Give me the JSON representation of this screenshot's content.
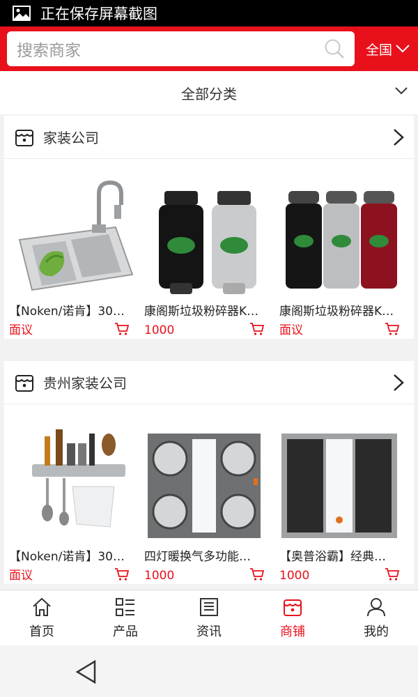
{
  "status_bar": {
    "text": "正在保存屏幕截图",
    "icon": "image-icon"
  },
  "search": {
    "placeholder": "搜索商家",
    "region": "全国"
  },
  "category_bar": {
    "label": "全部分类"
  },
  "shops": [
    {
      "name": "家装公司",
      "products": [
        {
          "title": "【Noken/诺肯】30…",
          "price": "面议",
          "image": "kitchen-sink"
        },
        {
          "title": "康阁斯垃圾粉碎器K…",
          "price": "1000",
          "image": "garbage-disposer-pair"
        },
        {
          "title": "康阁斯垃圾粉碎器K…",
          "price": "面议",
          "image": "garbage-disposer-trio"
        }
      ]
    },
    {
      "name": "贵州家装公司",
      "products": [
        {
          "title": "【Noken/诺肯】30…",
          "price": "面议",
          "image": "kitchen-rack"
        },
        {
          "title": "四灯暖换气多功能…",
          "price": "1000",
          "image": "bath-heater-four-lamp"
        },
        {
          "title": "【奥普浴霸】经典…",
          "price": "1000",
          "image": "bath-heater-fan"
        }
      ]
    }
  ],
  "tabs": [
    {
      "label": "首页",
      "icon": "home-icon",
      "active": false
    },
    {
      "label": "产品",
      "icon": "list-icon",
      "active": false
    },
    {
      "label": "资讯",
      "icon": "news-icon",
      "active": false
    },
    {
      "label": "商铺",
      "icon": "store-icon",
      "active": true
    },
    {
      "label": "我的",
      "icon": "user-icon",
      "active": false
    }
  ],
  "colors": {
    "brand_red": "#e8111b",
    "price_red": "#e8111b",
    "status_black": "#000000"
  }
}
